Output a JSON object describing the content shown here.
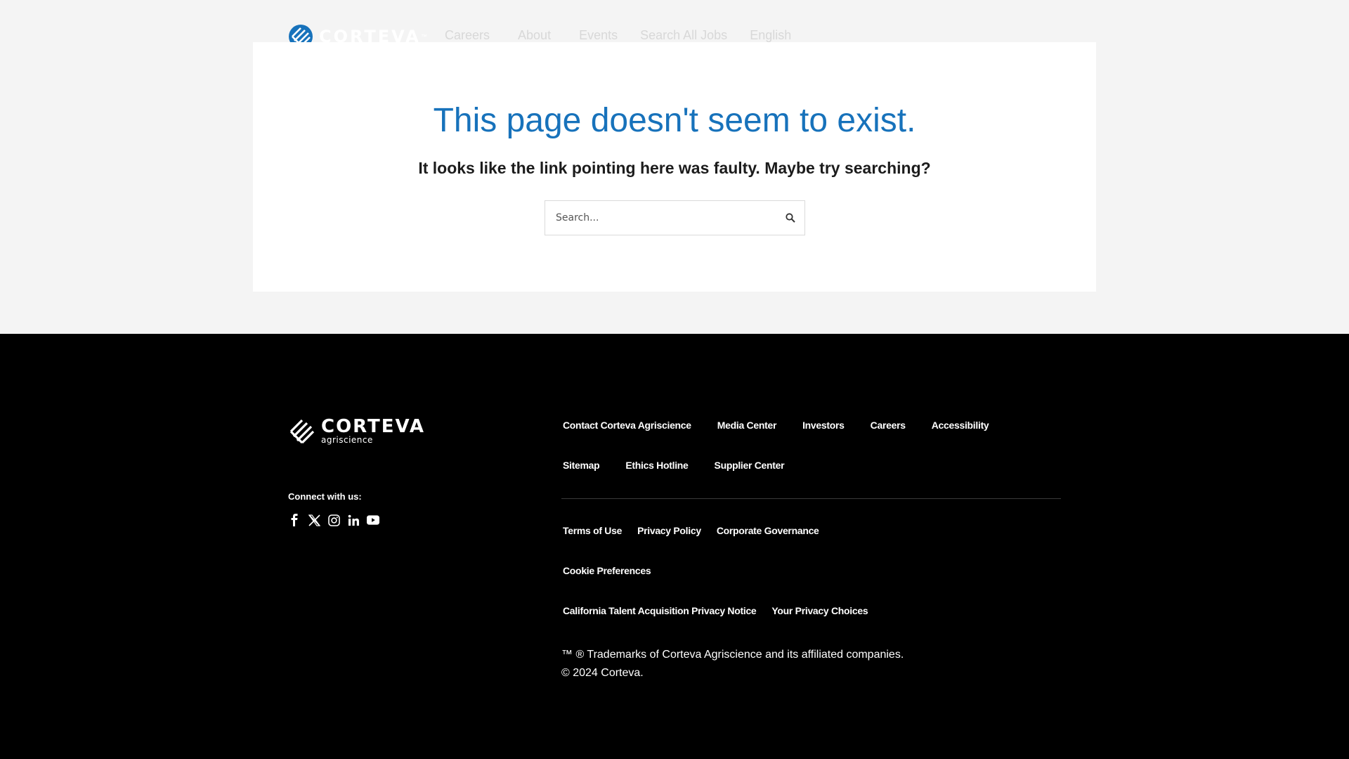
{
  "header": {
    "brand": "CORTEVA",
    "nav": [
      "Careers",
      "About",
      "Events",
      "Search All Jobs",
      "English"
    ]
  },
  "main": {
    "title": "This page doesn't seem to exist.",
    "subtitle": "It looks like the link pointing here was faulty. Maybe try searching?",
    "search_placeholder": "Search..."
  },
  "footer": {
    "brand": "CORTEVA",
    "brand_sub": "agriscience",
    "connect_label": "Connect with us:",
    "social_icons": [
      "facebook-icon",
      "x-icon",
      "instagram-icon",
      "linkedin-icon",
      "youtube-icon"
    ],
    "links_row1": [
      "Contact Corteva Agriscience",
      "Media Center",
      "Investors",
      "Careers",
      "Accessibility"
    ],
    "links_row2": [
      "Sitemap",
      "Ethics Hotline",
      "Supplier Center"
    ],
    "links_row3": [
      "Terms of Use",
      "Privacy Policy",
      "Corporate Governance"
    ],
    "links_row4": [
      "Cookie Preferences"
    ],
    "links_row5": [
      "California Talent Acquisition Privacy Notice",
      "Your Privacy Choices"
    ],
    "trademark": "™ ® Trademarks of Corteva Agriscience and its affiliated companies.",
    "copyright": "© 2024 Corteva."
  },
  "colors": {
    "accent": "#1772bb",
    "footer_bg": "#000000",
    "page_bg": "#f4f4f4"
  }
}
